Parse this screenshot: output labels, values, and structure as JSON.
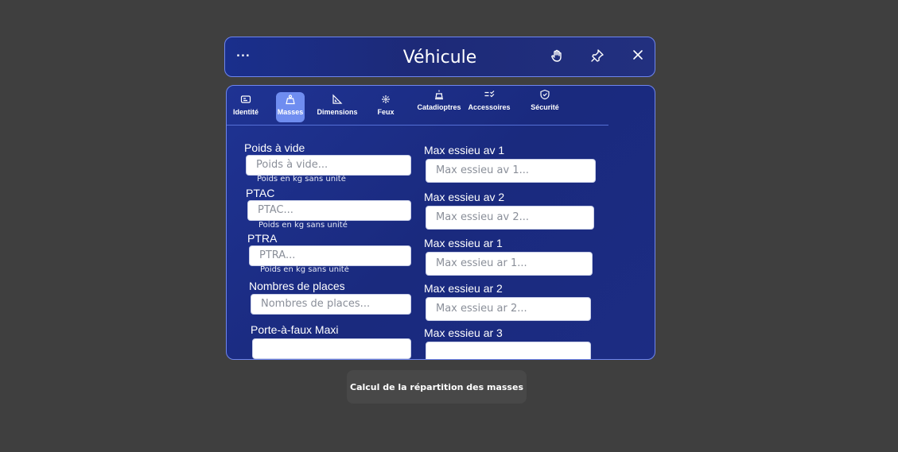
{
  "window": {
    "title": "Véhicule",
    "more_label": "...",
    "icons": [
      "hand-icon",
      "pin-icon",
      "close-icon"
    ]
  },
  "tabs": [
    {
      "label": "Identité",
      "icon": "id-card-icon",
      "active": false
    },
    {
      "label": "Masses",
      "icon": "weight-icon",
      "active": true
    },
    {
      "label": "Dimensions",
      "icon": "ruler-triangle-icon",
      "active": false
    },
    {
      "label": "Feux",
      "icon": "light-icon",
      "active": false
    },
    {
      "label": "Catadioptres",
      "icon": "reflector-icon",
      "active": false
    },
    {
      "label": "Accessoires",
      "icon": "checklist-icon",
      "active": false
    },
    {
      "label": "Sécurité",
      "icon": "shield-icon",
      "active": false
    }
  ],
  "left_fields": [
    {
      "label": "Poids à vide",
      "placeholder": "Poids à vide...",
      "hint": "Poids en kg sans unité"
    },
    {
      "label": "PTAC",
      "placeholder": "PTAC...",
      "hint": "Poids en kg sans unité"
    },
    {
      "label": "PTRA",
      "placeholder": "PTRA...",
      "hint": "Poids en kg sans unité"
    },
    {
      "label": "Nombres de places",
      "placeholder": "Nombres de places..."
    },
    {
      "label": "Porte-à-faux Maxi",
      "placeholder": ""
    }
  ],
  "right_fields": [
    {
      "label": "Max essieu av 1",
      "placeholder": "Max essieu av 1..."
    },
    {
      "label": "Max essieu av 2",
      "placeholder": "Max essieu av 2..."
    },
    {
      "label": "Max essieu ar 1",
      "placeholder": "Max essieu ar 1..."
    },
    {
      "label": "Max essieu ar 2",
      "placeholder": "Max essieu ar 2..."
    },
    {
      "label": "Max essieu ar 3",
      "placeholder": ""
    }
  ],
  "action": {
    "label": "Calcul de la répartition des masses"
  },
  "colors": {
    "panel": "#1d2d85",
    "border": "#6f86ee",
    "active_tab": "#6f8df0"
  }
}
